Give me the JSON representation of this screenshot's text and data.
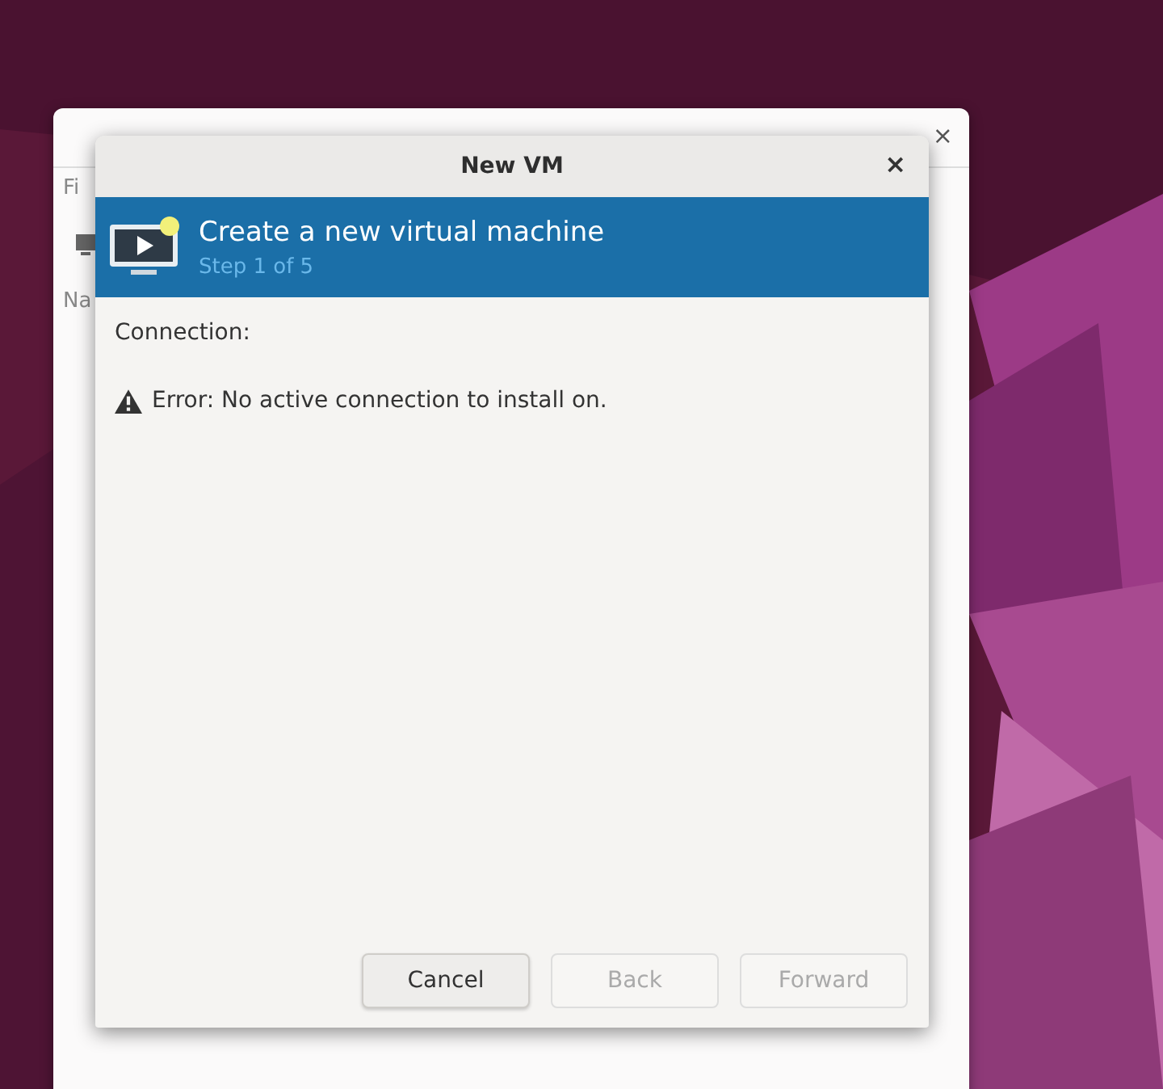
{
  "background_window": {
    "close": "×",
    "menu_stub": "Fi",
    "column_stub": "Na"
  },
  "dialog": {
    "title": "New VM",
    "close": "×",
    "header": {
      "title": "Create a new virtual machine",
      "step": "Step 1 of 5"
    },
    "connection_label": "Connection:",
    "error": "Error: No active connection to install on.",
    "buttons": [
      {
        "label": "Cancel",
        "disabled": false
      },
      {
        "label": "Back",
        "disabled": true
      },
      {
        "label": "Forward",
        "disabled": true
      }
    ]
  }
}
